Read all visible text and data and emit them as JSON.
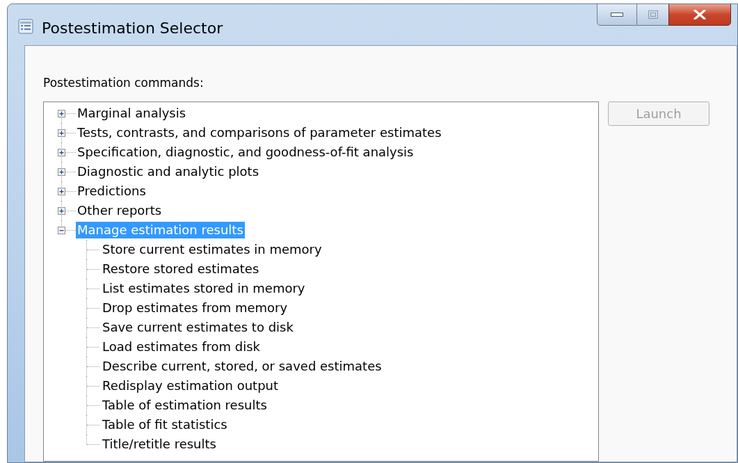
{
  "window": {
    "title": "Postestimation Selector"
  },
  "label": "Postestimation commands:",
  "tree": {
    "items": [
      {
        "label": "Marginal analysis",
        "expanded": false,
        "selected": false
      },
      {
        "label": "Tests, contrasts, and comparisons of parameter estimates",
        "expanded": false,
        "selected": false
      },
      {
        "label": "Specification, diagnostic, and goodness-of-fit analysis",
        "expanded": false,
        "selected": false
      },
      {
        "label": "Diagnostic and analytic plots",
        "expanded": false,
        "selected": false
      },
      {
        "label": "Predictions",
        "expanded": false,
        "selected": false
      },
      {
        "label": "Other reports",
        "expanded": false,
        "selected": false
      },
      {
        "label": "Manage estimation results",
        "expanded": true,
        "selected": true,
        "children": [
          {
            "label": "Store current estimates in memory",
            "selected": false
          },
          {
            "label": "Restore stored estimates",
            "selected": false
          },
          {
            "label": "List estimates stored in memory",
            "selected": false
          },
          {
            "label": "Drop estimates from memory",
            "selected": false
          },
          {
            "label": "Save current estimates to disk",
            "selected": false
          },
          {
            "label": "Load estimates from disk",
            "selected": false
          },
          {
            "label": "Describe current, stored, or saved estimates",
            "selected": false
          },
          {
            "label": "Redisplay estimation output",
            "selected": false
          },
          {
            "label": "Table of estimation results",
            "selected": false
          },
          {
            "label": "Table of fit statistics",
            "selected": false
          },
          {
            "label": "Title/retitle results",
            "selected": false
          }
        ]
      }
    ]
  },
  "launch_button": {
    "label": "Launch",
    "disabled": true
  }
}
